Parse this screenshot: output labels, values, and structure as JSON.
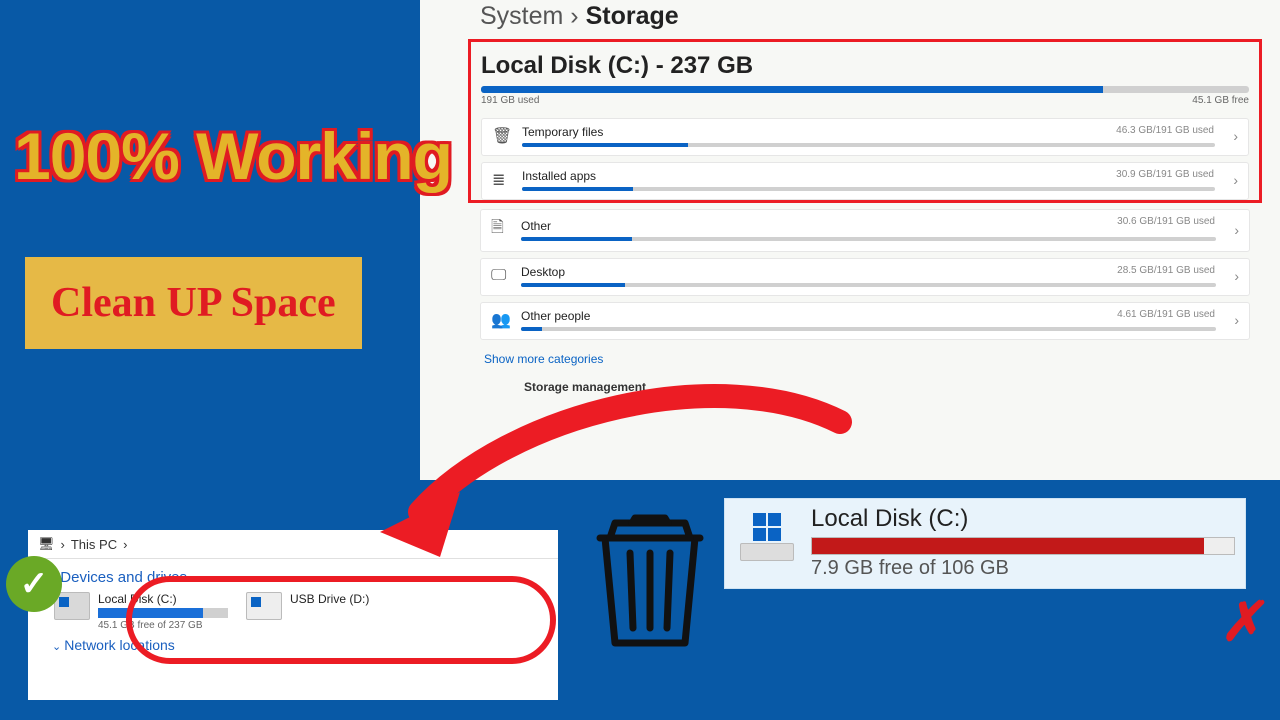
{
  "breadcrumb": {
    "parent": "System",
    "here": "Storage"
  },
  "disk": {
    "title": "Local Disk (C:) - 237 GB",
    "used_label": "191 GB used",
    "free_label": "45.1 GB free",
    "fill_pct": 81
  },
  "categories": [
    {
      "name": "Temporary files",
      "used": "46.3 GB/191 GB used",
      "pct": 24,
      "icon": "trash-icon"
    },
    {
      "name": "Installed apps",
      "used": "30.9 GB/191 GB used",
      "pct": 16,
      "icon": "apps-icon"
    },
    {
      "name": "Other",
      "used": "30.6 GB/191 GB used",
      "pct": 16,
      "icon": "file-icon"
    },
    {
      "name": "Desktop",
      "used": "28.5 GB/191 GB used",
      "pct": 15,
      "icon": "monitor-icon"
    },
    {
      "name": "Other people",
      "used": "4.61 GB/191 GB used",
      "pct": 3,
      "icon": "people-icon"
    }
  ],
  "show_more": "Show more categories",
  "mgmt_heading": "Storage management",
  "overlay": {
    "headline": "100% Working",
    "subhead": "Clean UP Space"
  },
  "explorer": {
    "breadcrumb": "This PC",
    "section": "Devices and drives",
    "drives": [
      {
        "name": "Local Disk (C:)",
        "free": "45.1 GB free of 237 GB",
        "pct": 81,
        "icon": "hdd-icon"
      },
      {
        "name": "USB Drive (D:)",
        "free": "",
        "pct": 0,
        "icon": "usb-icon"
      }
    ],
    "netloc": "Network locations"
  },
  "red_disk": {
    "title": "Local Disk (C:)",
    "free": "7.9 GB free of 106 GB",
    "pct": 93
  }
}
